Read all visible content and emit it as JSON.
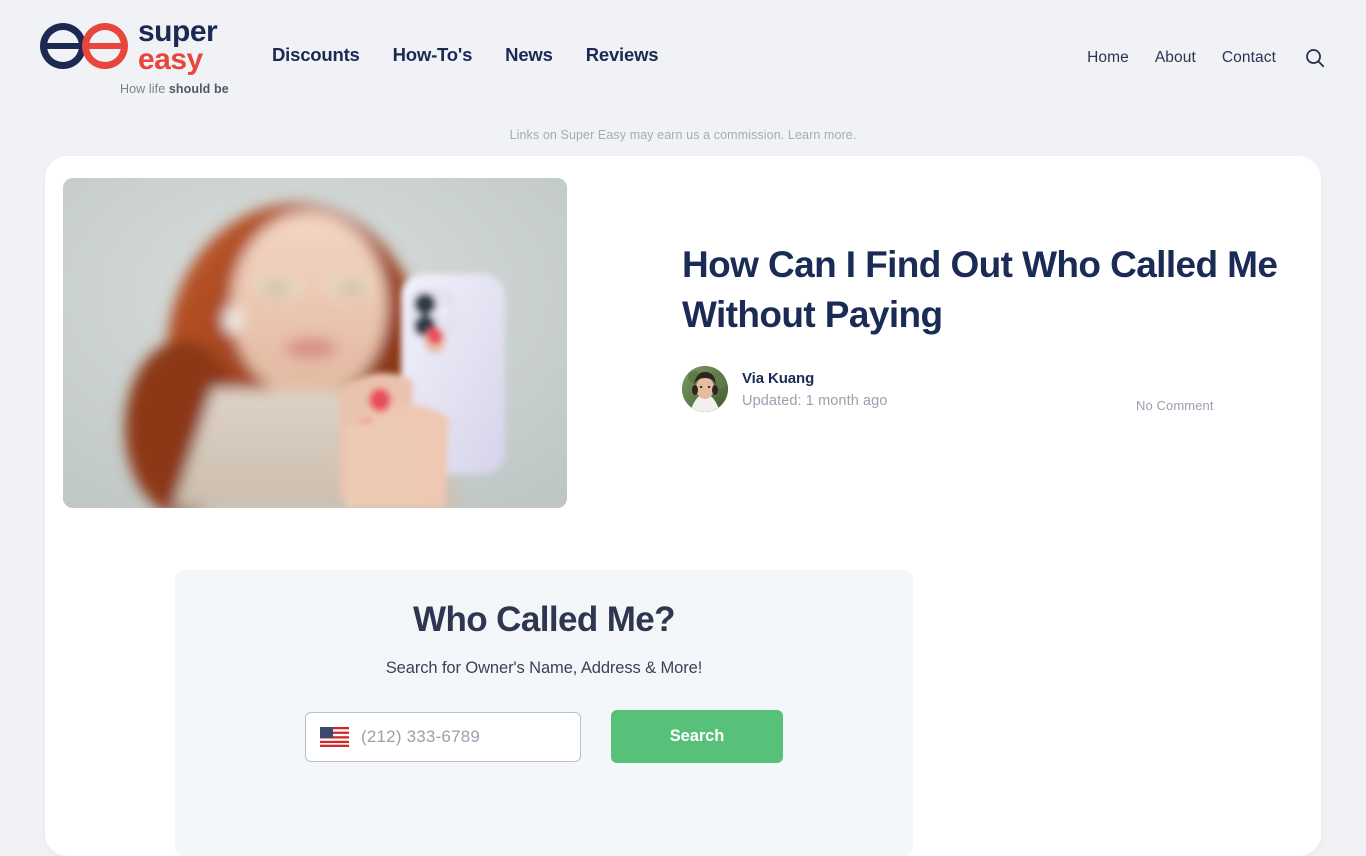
{
  "brand": {
    "name_line1": "super",
    "name_line2": "easy",
    "tagline_prefix": "How life ",
    "tagline_strong": "should be",
    "navy": "#1c2a53",
    "red": "#e8463c"
  },
  "header": {
    "primary_nav": [
      {
        "label": "Discounts"
      },
      {
        "label": "How-To's"
      },
      {
        "label": "News"
      },
      {
        "label": "Reviews"
      }
    ],
    "secondary_nav": [
      {
        "label": "Home"
      },
      {
        "label": "About"
      },
      {
        "label": "Contact"
      }
    ],
    "search_icon": "search-icon"
  },
  "disclaimer": {
    "text": "Links on Super Easy may earn us a commission. Learn more."
  },
  "article": {
    "title": "How Can I Find Out Who Called Me Without Paying",
    "author": "Via Kuang",
    "updated": "Updated: 1 month ago",
    "comments": "No Comment",
    "hero_alt": "woman-with-phone-photo",
    "avatar_alt": "author-avatar-photo"
  },
  "widget": {
    "title": "Who Called Me?",
    "subtitle": "Search for Owner's Name, Address & More!",
    "flag_icon": "us-flag-icon",
    "phone_placeholder": "(212) 333-6789",
    "phone_value": "",
    "search_label": "Search",
    "accent_green": "#57c179"
  }
}
